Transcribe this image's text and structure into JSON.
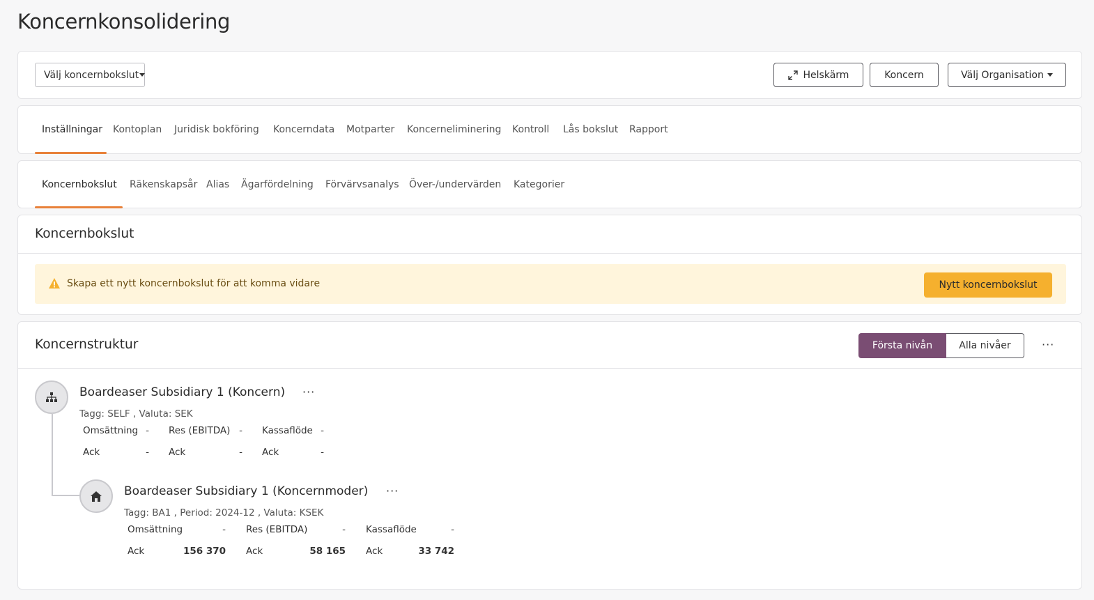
{
  "page": {
    "title": "Koncernkonsolidering"
  },
  "topbar": {
    "select_label": "Välj koncernbokslut",
    "fullscreen_label": "Helskärm",
    "koncern_label": "Koncern",
    "org_label": "Välj Organisation"
  },
  "main_tabs": [
    "Inställningar",
    "Kontoplan",
    "Juridisk bokföring",
    "Koncerndata",
    "Motparter",
    "Koncerneliminering",
    "Kontroll",
    "Lås bokslut",
    "Rapport"
  ],
  "sub_tabs": [
    "Koncernbokslut",
    "Räkenskapsår",
    "Alias",
    "Ägarfördelning",
    "Förvärvsanalys",
    "Över-/undervärden",
    "Kategorier"
  ],
  "koncernbokslut": {
    "title": "Koncernbokslut",
    "alert_text": "Skapa ett nytt koncernbokslut för att komma vidare",
    "new_button": "Nytt koncernbokslut"
  },
  "structure": {
    "title": "Koncernstruktur",
    "level_first": "Första nivån",
    "level_all": "Alla nivåer",
    "more": "···",
    "nodes": [
      {
        "name": "Boardeaser Subsidiary 1 (Koncern)",
        "meta": "Tagg: SELF , Valuta: SEK",
        "more": "···",
        "metrics": [
          {
            "label": "Omsättning",
            "value": "-",
            "ack_label": "Ack",
            "ack_value": "-"
          },
          {
            "label": "Res (EBITDA)",
            "value": "-",
            "ack_label": "Ack",
            "ack_value": "-"
          },
          {
            "label": "Kassaflöde",
            "value": "-",
            "ack_label": "Ack",
            "ack_value": "-"
          }
        ]
      },
      {
        "name": "Boardeaser Subsidiary 1 (Koncernmoder)",
        "meta": "Tagg: BA1 , Period: 2024-12 , Valuta: KSEK",
        "more": "···",
        "metrics": [
          {
            "label": "Omsättning",
            "value": "-",
            "ack_label": "Ack",
            "ack_value": "156 370"
          },
          {
            "label": "Res (EBITDA)",
            "value": "-",
            "ack_label": "Ack",
            "ack_value": "58 165"
          },
          {
            "label": "Kassaflöde",
            "value": "-",
            "ack_label": "Ack",
            "ack_value": "33 742"
          }
        ]
      }
    ]
  },
  "colors": {
    "accent": "#e8813a",
    "primary": "#7a4d73",
    "warning_bg": "#fff5dc",
    "warning_btn": "#f5b02e"
  }
}
